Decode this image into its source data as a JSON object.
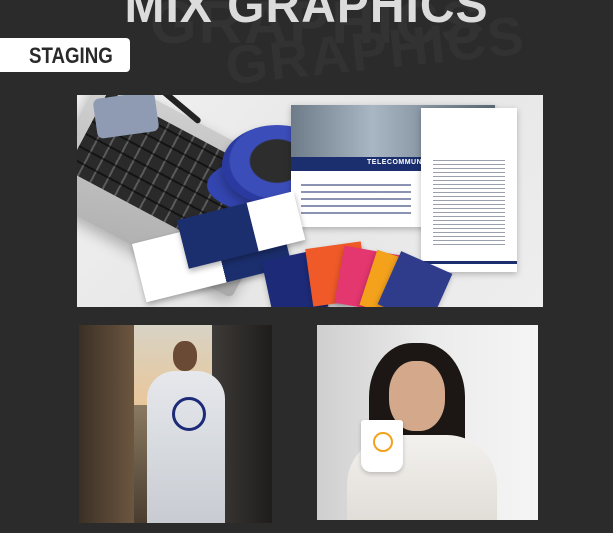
{
  "header": {
    "title": "MIX GRAPHICS",
    "background_echo": "GRAPHICS"
  },
  "section": {
    "tag_label": "STAGING"
  },
  "top_mockup": {
    "flyer_band_text": "TELECOMMUNICATION"
  },
  "colors": {
    "page_background": "#2b2b2b",
    "tag_background": "#ffffff",
    "brand_navy": "#1b2f6e",
    "accent_orange": "#f05a28",
    "accent_pink": "#e4366f",
    "accent_yellow": "#f4a21c"
  }
}
